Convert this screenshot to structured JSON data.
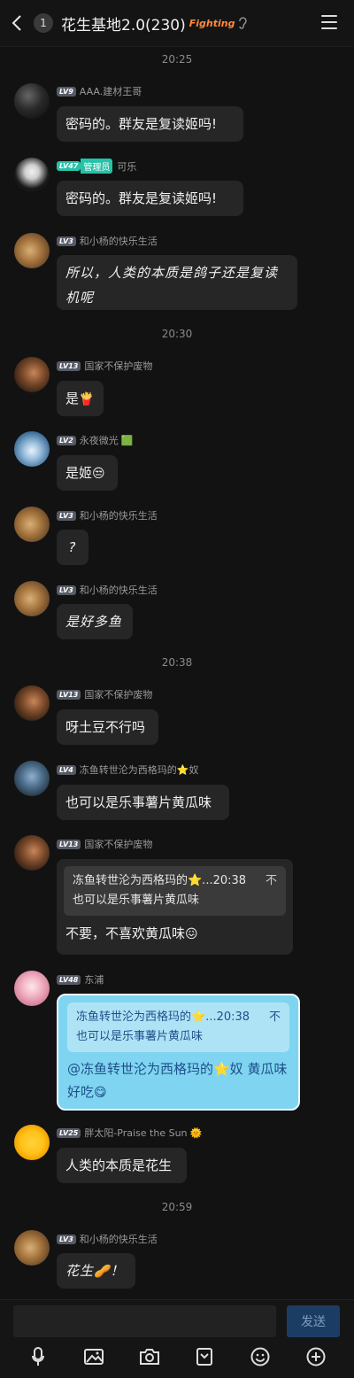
{
  "header": {
    "unread_count": "1",
    "title": "花生基地2.0(230)",
    "title_decoration": "Fighting",
    "icons": [
      "back-arrow-icon",
      "ear-icon",
      "menu-icon"
    ]
  },
  "timestamps": [
    "20:25",
    "20:30",
    "20:38",
    "20:59"
  ],
  "messages": [
    {
      "level": "LV9",
      "name": "AAA.建材王哥",
      "text": "密码的。群友是复读姬吗!"
    },
    {
      "level": "LV47",
      "role": "管理员",
      "name": "可乐",
      "text": "密码的。群友是复读姬吗!"
    },
    {
      "level": "LV3",
      "name": "和小杨的快乐生活",
      "text": "所以，人类的本质是鸽子还是复读机呢"
    },
    {
      "level": "LV13",
      "name": "国家不保护废物",
      "text": "是",
      "emoji": "🍟"
    },
    {
      "level": "LV2",
      "name": "永夜微光",
      "name_emoji": "🟩",
      "text": "是姬",
      "emoji": "😒"
    },
    {
      "level": "LV3",
      "name": "和小杨的快乐生活",
      "text": "?"
    },
    {
      "level": "LV3",
      "name": "和小杨的快乐生活",
      "text": "是好多鱼"
    },
    {
      "level": "LV13",
      "name": "国家不保护废物",
      "text": "呀土豆不行吗"
    },
    {
      "level": "LV4",
      "name": "冻鱼转世沦为西格玛的⭐奴",
      "text": "也可以是乐事薯片黄瓜味"
    },
    {
      "level": "LV13",
      "name": "国家不保护废物",
      "quote": {
        "head": "冻鱼转世沦为西格玛的⭐...20:38",
        "close": "不",
        "body": "也可以是乐事薯片黄瓜味"
      },
      "text": "不要，不喜欢黄瓜味",
      "emoji": "😖"
    },
    {
      "level": "LV48",
      "name": "东浦",
      "quote": {
        "head": "冻鱼转世沦为西格玛的⭐...20:38",
        "close": "不",
        "body": "也可以是乐事薯片黄瓜味"
      },
      "text": "@冻鱼转世沦为西格玛的⭐奴 黄瓜味好吃",
      "emoji": "😋"
    },
    {
      "level": "LV25",
      "name": "胖太阳-Praise the Sun",
      "name_emoji": "🌞",
      "text": "人类的本质是花生"
    },
    {
      "level": "LV3",
      "name": "和小杨的快乐生活",
      "text": "花生",
      "emoji": "🥜",
      "text_after": "！"
    }
  ],
  "composer": {
    "placeholder": "",
    "send_label": "发送",
    "tools": [
      "microphone-icon",
      "image-icon",
      "camera-icon",
      "sticker-icon",
      "emoji-icon",
      "plus-icon"
    ]
  },
  "colors": {
    "background": "#121212",
    "bubble": "#262626",
    "highlight_bubble": "#7fd5f1",
    "admin": "#27c2a8",
    "send_button": "#1c3d63"
  }
}
